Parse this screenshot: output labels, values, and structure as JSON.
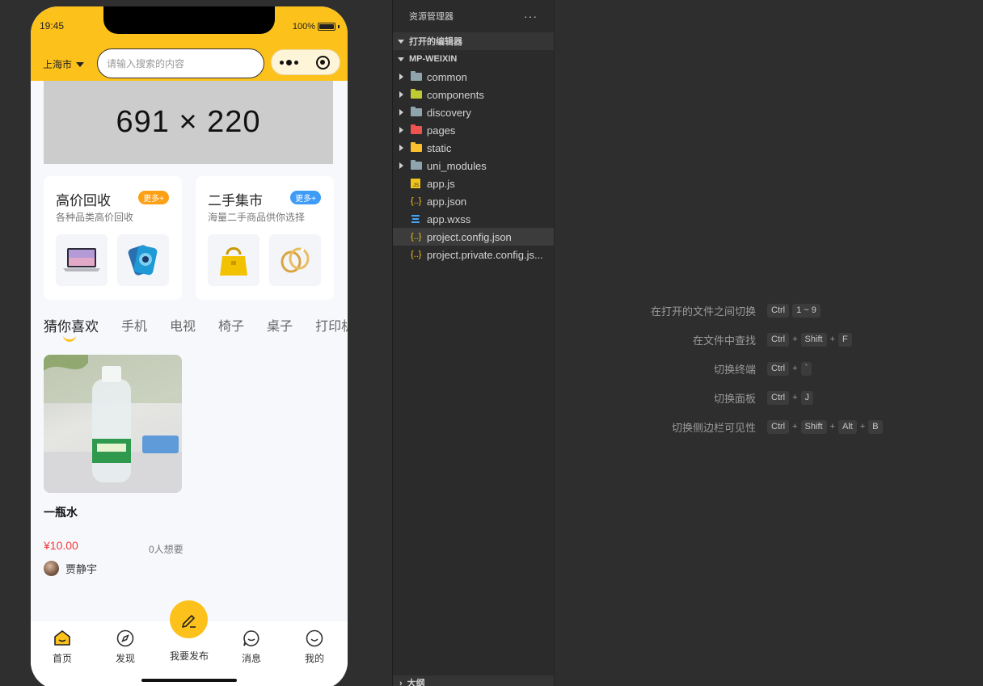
{
  "simulator": {
    "status": {
      "time": "19:45",
      "battery": "100%"
    },
    "header": {
      "city": "上海市",
      "search_placeholder": "请输入搜索的内容"
    },
    "banner": {
      "placeholder_text": "691 × 220"
    },
    "cards": [
      {
        "title": "高价回收",
        "subtitle": "各种品类高价回收",
        "more": "更多+",
        "accent": "#fca016",
        "thumbs": [
          "laptop-image",
          "phone-image"
        ]
      },
      {
        "title": "二手集市",
        "subtitle": "海量二手商品供你选择",
        "more": "更多+",
        "accent": "#3e9bf6",
        "thumbs": [
          "handbag-image",
          "rings-image"
        ]
      }
    ],
    "tabs": [
      "猜你喜欢",
      "手机",
      "电视",
      "椅子",
      "桌子",
      "打印机"
    ],
    "product": {
      "title": "一瓶水",
      "price": "¥10.00",
      "wants": "0人想要",
      "seller": "贾静宇"
    },
    "tabbar": [
      {
        "label": "首页",
        "icon": "home-icon",
        "active": true
      },
      {
        "label": "发现",
        "icon": "compass-icon",
        "active": false
      },
      {
        "label": "我要发布",
        "icon": "pencil-icon",
        "active": false
      },
      {
        "label": "消息",
        "icon": "message-icon",
        "active": false
      },
      {
        "label": "我的",
        "icon": "smile-icon",
        "active": false
      }
    ],
    "colors": {
      "brand": "#fcc21b",
      "price": "#ee3b3b"
    }
  },
  "explorer": {
    "title": "资源管理器",
    "more": "···",
    "sections": {
      "open_editors": "打开的编辑器",
      "project": "MP-WEIXIN",
      "outline": "大纲"
    },
    "folders": [
      {
        "name": "common",
        "color": "#90a4ae"
      },
      {
        "name": "components",
        "color": "#c0ca33"
      },
      {
        "name": "discovery",
        "color": "#90a4ae"
      },
      {
        "name": "pages",
        "color": "#ef5350"
      },
      {
        "name": "static",
        "color": "#fbc02d"
      },
      {
        "name": "uni_modules",
        "color": "#90a4ae"
      }
    ],
    "files": [
      {
        "name": "app.js",
        "icon": "js-icon"
      },
      {
        "name": "app.json",
        "icon": "json-icon"
      },
      {
        "name": "app.wxss",
        "icon": "css-icon"
      },
      {
        "name": "project.config.json",
        "icon": "json-icon",
        "selected": true
      },
      {
        "name": "project.private.config.js...",
        "icon": "json-icon"
      }
    ]
  },
  "editor": {
    "shortcuts": [
      {
        "label": "在打开的文件之间切换",
        "keys": [
          "Ctrl",
          "1 ~ 9"
        ],
        "joined": false
      },
      {
        "label": "在文件中查找",
        "keys": [
          "Ctrl",
          "Shift",
          "F"
        ],
        "joined": true
      },
      {
        "label": "切换终端",
        "keys": [
          "Ctrl",
          "`"
        ],
        "joined": true
      },
      {
        "label": "切换面板",
        "keys": [
          "Ctrl",
          "J"
        ],
        "joined": true
      },
      {
        "label": "切换侧边栏可见性",
        "keys": [
          "Ctrl",
          "Shift",
          "Alt",
          "B"
        ],
        "joined": true
      }
    ]
  }
}
